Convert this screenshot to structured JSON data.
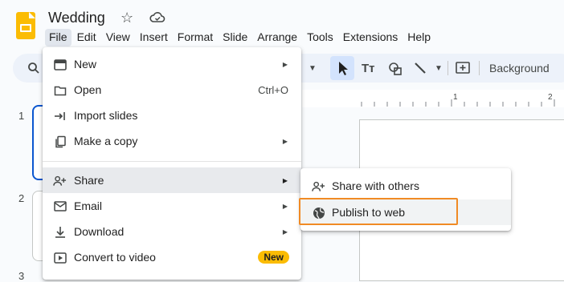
{
  "app": {
    "title": "Wedding",
    "menubar": [
      "File",
      "Edit",
      "View",
      "Insert",
      "Format",
      "Slide",
      "Arrange",
      "Tools",
      "Extensions",
      "Help"
    ]
  },
  "toolbar": {
    "background_label": "Background"
  },
  "ruler": {
    "marks": [
      "1",
      "2"
    ]
  },
  "slides": {
    "numbers": [
      "1",
      "2",
      "3"
    ]
  },
  "file_menu": {
    "items": [
      {
        "label": "New",
        "icon": "new-slides-icon"
      },
      {
        "label": "Open",
        "shortcut": "Ctrl+O",
        "icon": "folder-icon"
      },
      {
        "label": "Import slides",
        "icon": "import-icon"
      },
      {
        "label": "Make a copy",
        "icon": "copy-icon"
      },
      {
        "label": "Share",
        "icon": "person-add-icon"
      },
      {
        "label": "Email",
        "icon": "email-icon"
      },
      {
        "label": "Download",
        "icon": "download-icon"
      },
      {
        "label": "Convert to video",
        "badge": "New",
        "icon": "video-icon"
      }
    ]
  },
  "share_submenu": {
    "items": [
      {
        "label": "Share with others",
        "icon": "person-add-icon"
      },
      {
        "label": "Publish to web",
        "icon": "globe-icon"
      }
    ]
  },
  "colors": {
    "accent": "#0b57d0",
    "logo": "#fbbc04",
    "highlight_border": "#f08a24",
    "badge": "#fbbc04"
  }
}
